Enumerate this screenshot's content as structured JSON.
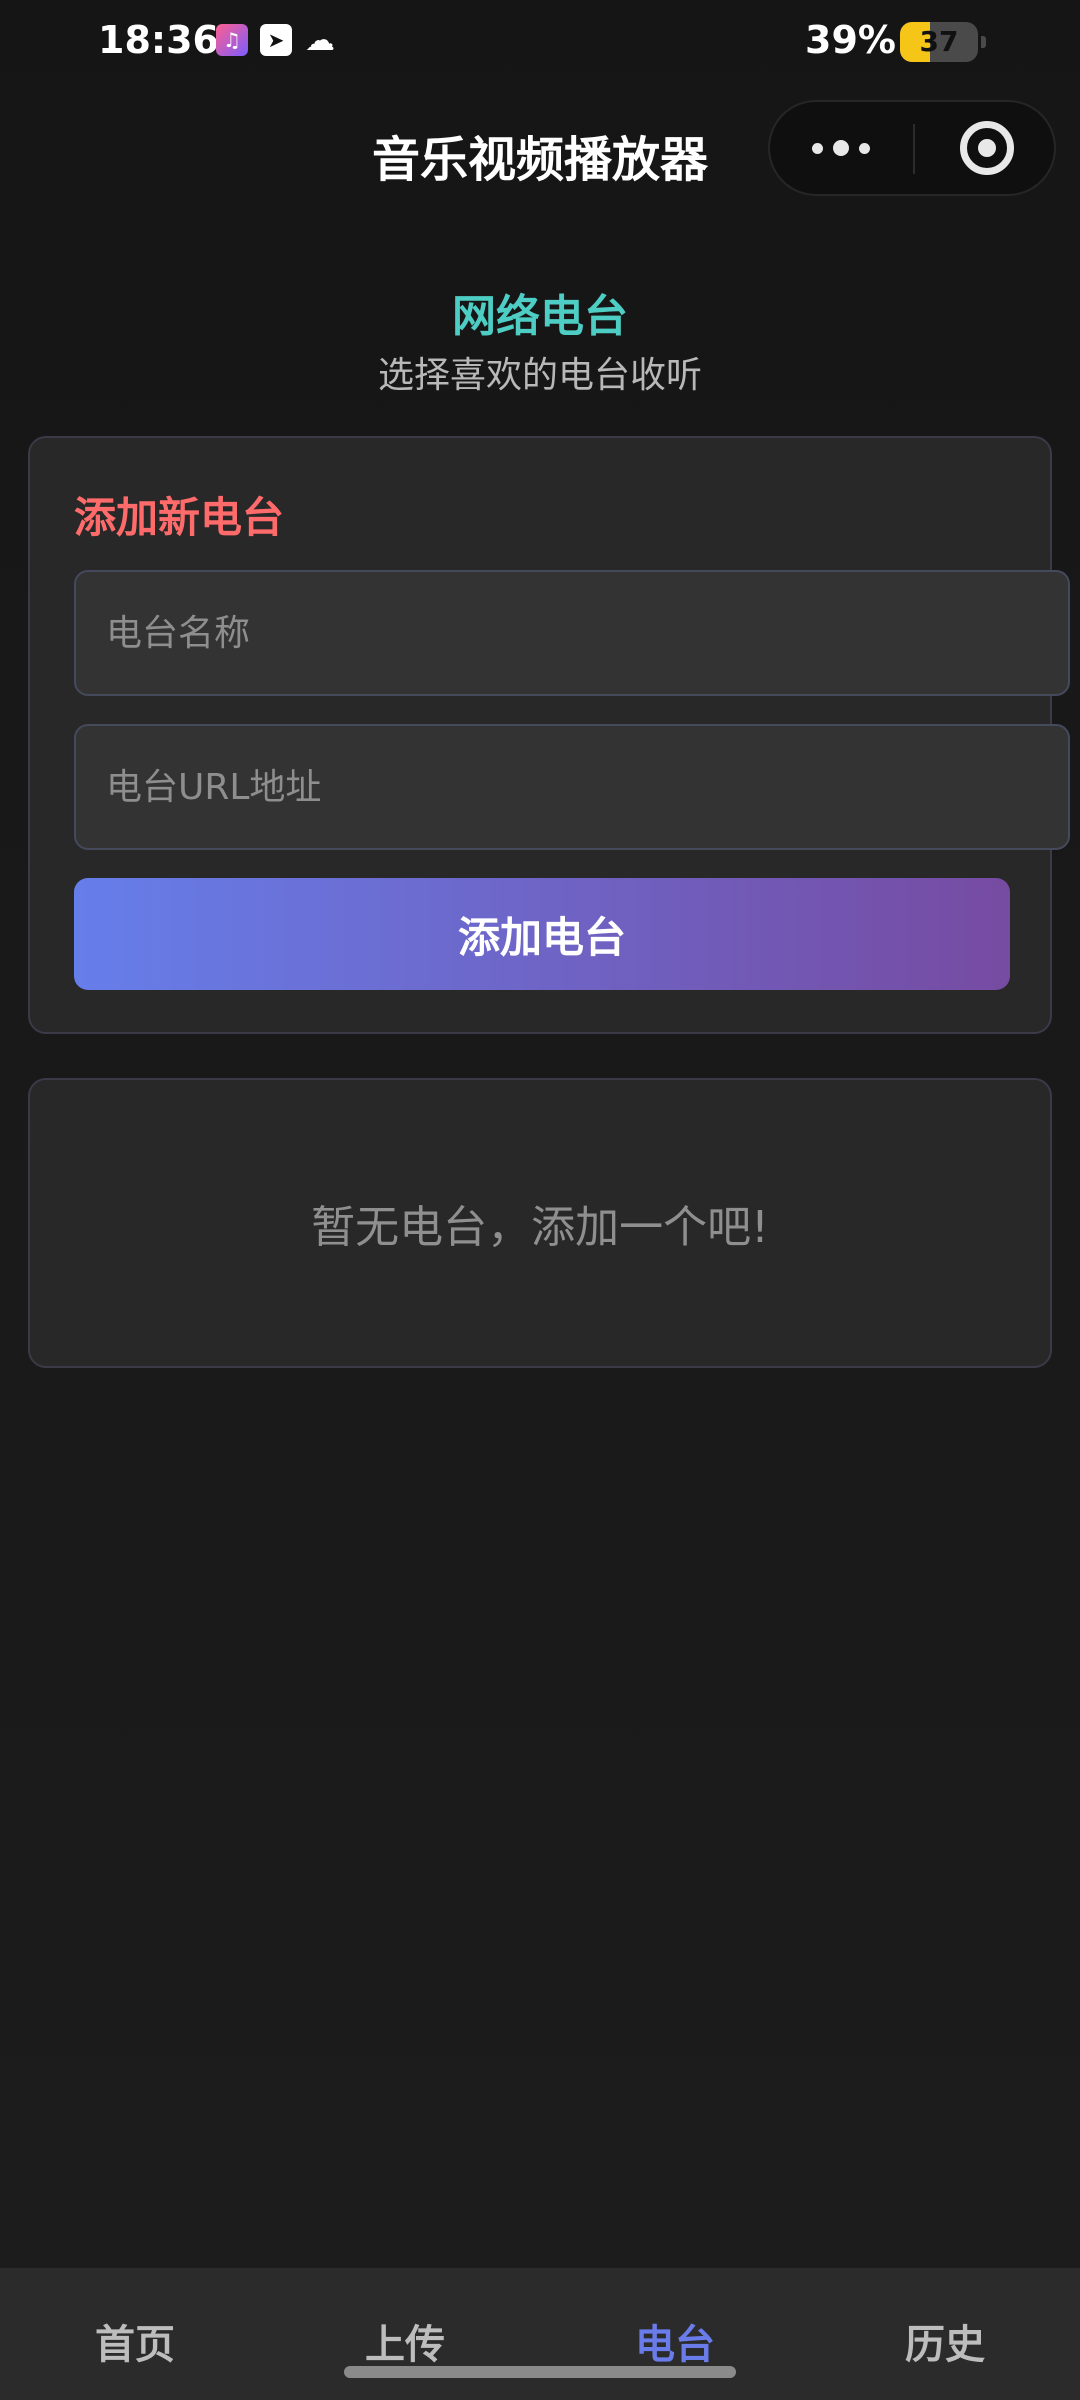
{
  "status_bar": {
    "time": "18:36",
    "battery_percent": "39%",
    "battery_level": "37",
    "battery_fill_fraction": 0.39,
    "icons": [
      "music-app-icon",
      "send-icon",
      "cloud-icon"
    ]
  },
  "title_bar": {
    "title": "音乐视频播放器",
    "more_icon": "more-dots-icon",
    "close_icon": "target-close-icon"
  },
  "header": {
    "title": "网络电台",
    "subtitle": "选择喜欢的电台收听"
  },
  "add_card": {
    "title": "添加新电台",
    "name_placeholder": "电台名称",
    "name_value": "",
    "url_placeholder": "电台URL地址",
    "url_value": "",
    "add_button_label": "添加电台"
  },
  "empty_state": {
    "text": "暂无电台，添加一个吧!"
  },
  "tabs": [
    {
      "label": "首页",
      "active": false
    },
    {
      "label": "上传",
      "active": false
    },
    {
      "label": "电台",
      "active": true
    },
    {
      "label": "历史",
      "active": false
    }
  ],
  "colors": {
    "accent_teal": "#4ecdc4",
    "accent_red": "#ff6b6b",
    "button_gradient_start": "#667eea",
    "button_gradient_end": "#764ba2",
    "tab_active": "#6a7bea"
  }
}
